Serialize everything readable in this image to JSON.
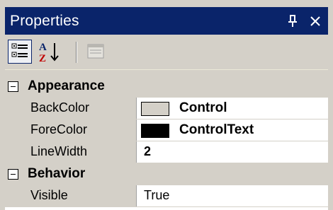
{
  "window": {
    "title": "Properties",
    "pin_glyph": "P",
    "close_glyph": "✕"
  },
  "toolbar": {
    "categorized_icon": "categorized-icon",
    "alphabetical_icon": "alphabetical-sort-icon",
    "property_pages_icon": "property-pages-icon"
  },
  "grid": {
    "categories": [
      {
        "label": "Appearance",
        "properties": [
          {
            "name": "BackColor",
            "value": "Control",
            "swatch": "#d4d0c8"
          },
          {
            "name": "ForeColor",
            "value": "ControlText",
            "swatch": "#000000"
          },
          {
            "name": "LineWidth",
            "value": "2"
          }
        ]
      },
      {
        "label": "Behavior",
        "properties": [
          {
            "name": "Visible",
            "value": "True"
          }
        ]
      }
    ]
  },
  "colors": {
    "titlebar": "#0a246a",
    "panel": "#d4d0c8",
    "grid_bg": "#ffffff"
  }
}
